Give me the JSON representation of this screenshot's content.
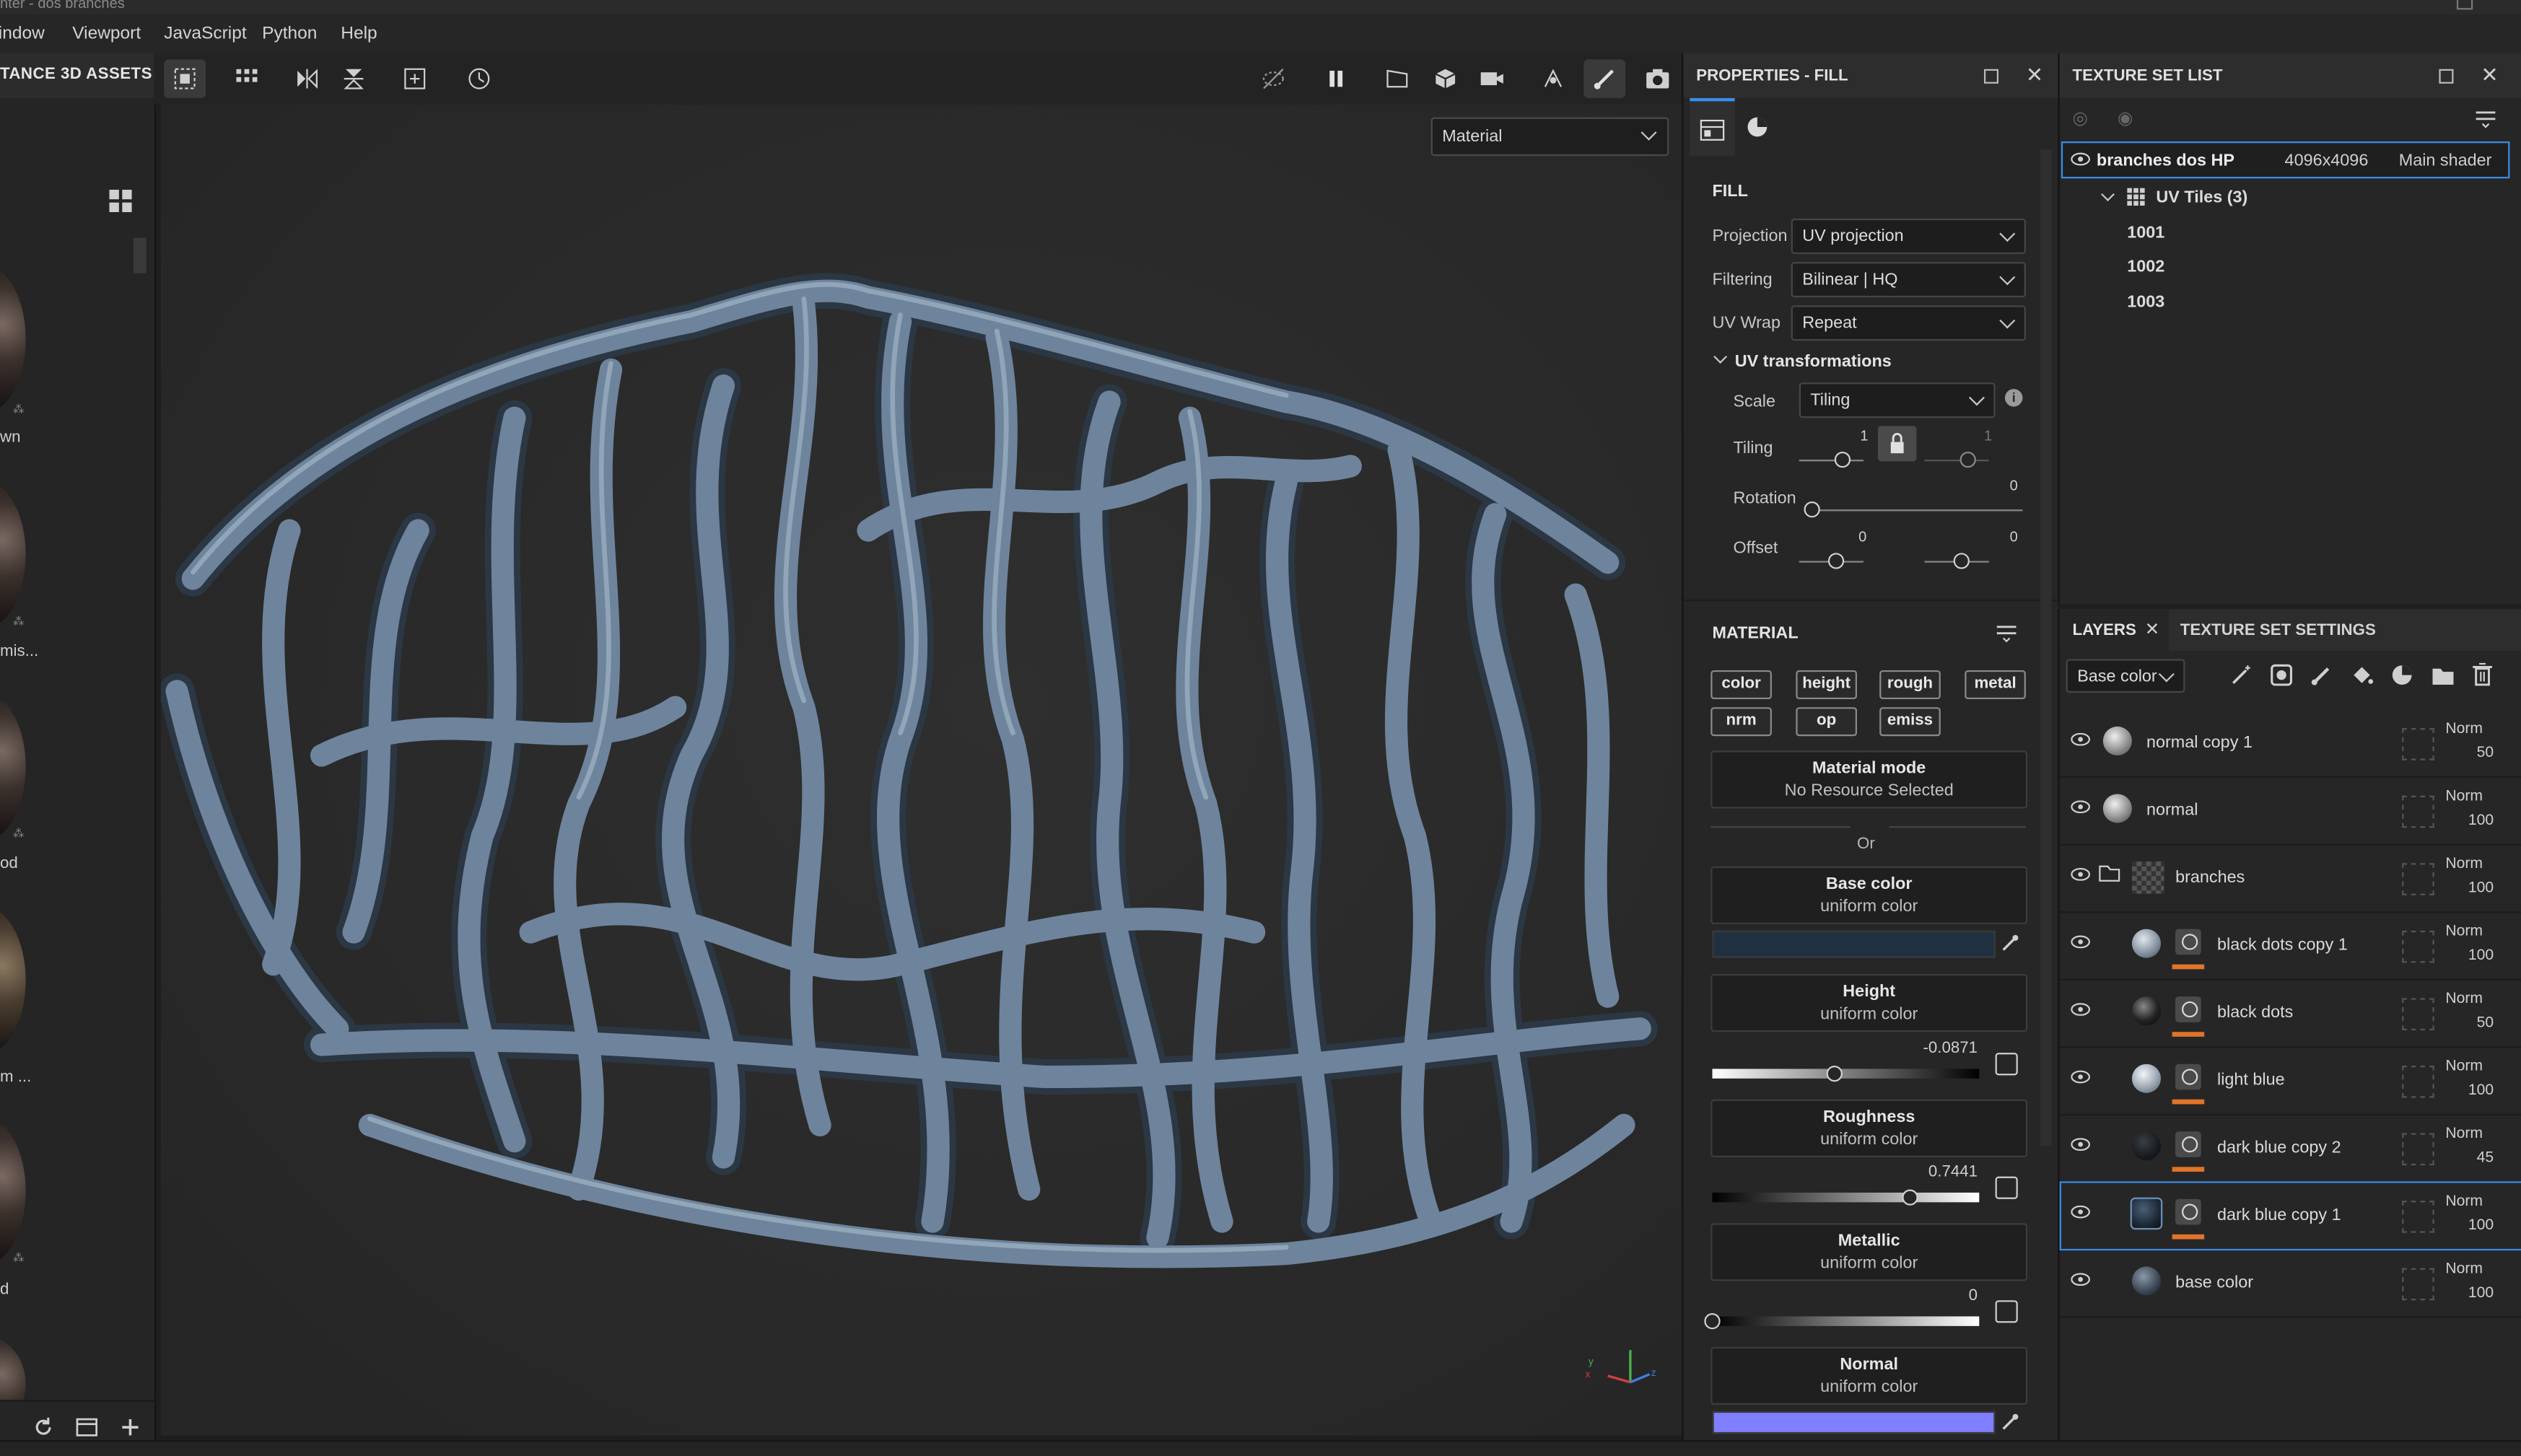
{
  "window": {
    "title": "inter - dos branches"
  },
  "menu": [
    "indow",
    "Viewport",
    "JavaScript",
    "Python",
    "Help"
  ],
  "assets": {
    "header": "TANCE 3D ASSETS",
    "items": [
      {
        "label": "wn"
      },
      {
        "label": "mis..."
      },
      {
        "label": "od"
      },
      {
        "label": "m ..."
      },
      {
        "label": "d"
      }
    ]
  },
  "viewport": {
    "mode_select": "Material",
    "axis": {
      "x": "x",
      "y": "y",
      "z": "z"
    }
  },
  "properties": {
    "title": "PROPERTIES - FILL",
    "fill": {
      "heading": "FILL",
      "projection_label": "Projection",
      "projection_value": "UV projection",
      "filtering_label": "Filtering",
      "filtering_value": "Bilinear | HQ",
      "uvwrap_label": "UV Wrap",
      "uvwrap_value": "Repeat",
      "uvtrans_label": "UV transformations",
      "scale_label": "Scale",
      "scale_value": "Tiling",
      "tiling_label": "Tiling",
      "tiling_u": "1",
      "tiling_v": "1",
      "rotation_label": "Rotation",
      "rotation_value": "0",
      "offset_label": "Offset",
      "offset_u": "0",
      "offset_v": "0"
    },
    "material": {
      "heading": "MATERIAL",
      "channels_row1": [
        "color",
        "height",
        "rough",
        "metal"
      ],
      "channels_row2": [
        "nrm",
        "op",
        "emiss"
      ],
      "mode_title": "Material mode",
      "mode_sub": "No Resource Selected",
      "or_text": "Or",
      "base_color": {
        "title": "Base color",
        "sub": "uniform color",
        "swatch": "#1f3040"
      },
      "height": {
        "title": "Height",
        "sub": "uniform color",
        "value": "-0.0871",
        "fraction": 0.46
      },
      "roughness": {
        "title": "Roughness",
        "sub": "uniform color",
        "value": "0.7441",
        "fraction": 0.74
      },
      "metallic": {
        "title": "Metallic",
        "sub": "uniform color",
        "value": "0",
        "fraction": 0.0
      },
      "normal": {
        "title": "Normal",
        "sub": "uniform color",
        "swatch": "#7f7fff"
      }
    }
  },
  "texture_set_list": {
    "title": "TEXTURE SET LIST",
    "set_name": "branches dos HP",
    "resolution": "4096x4096",
    "shader": "Main shader",
    "uv_tiles_label": "UV Tiles (3)",
    "tiles": [
      "1001",
      "1002",
      "1003"
    ]
  },
  "layers_panel": {
    "tab_layers": "LAYERS",
    "tab_tss": "TEXTURE SET SETTINGS",
    "channel_select": "Base color",
    "layers": [
      {
        "name": "normal copy 1",
        "blend": "Norm",
        "opacity": "50"
      },
      {
        "name": "normal",
        "blend": "Norm",
        "opacity": "100"
      },
      {
        "name": "branches",
        "blend": "Norm",
        "opacity": "100"
      },
      {
        "name": "black dots copy 1",
        "blend": "Norm",
        "opacity": "100"
      },
      {
        "name": "black dots",
        "blend": "Norm",
        "opacity": "50"
      },
      {
        "name": "light blue",
        "blend": "Norm",
        "opacity": "100"
      },
      {
        "name": "dark blue copy 2",
        "blend": "Norm",
        "opacity": "45"
      },
      {
        "name": "dark blue copy 1",
        "blend": "Norm",
        "opacity": "100"
      },
      {
        "name": "base color",
        "blend": "Norm",
        "opacity": "100"
      }
    ]
  },
  "colors": {
    "accent": "#3a8de8",
    "mask_bar": "#e0742a",
    "branch": "#7a8fa5"
  }
}
